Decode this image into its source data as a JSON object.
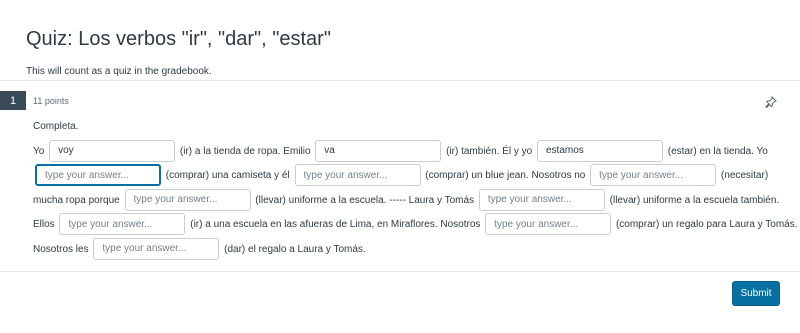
{
  "page": {
    "title": "Quiz: Los verbos \"ir\", \"dar\", \"estar\"",
    "subtitle": "This will count as a quiz in the gradebook."
  },
  "question": {
    "number": "1",
    "points": "11 points",
    "flag_icon": "pin-icon",
    "intro": "Completa.",
    "placeholder": "type your answer...",
    "answers": {
      "a1": "voy",
      "a2": "va",
      "a3": "estamos"
    },
    "text": {
      "t1": "Yo",
      "t2": "(ir) a la tienda de ropa. Emilio",
      "t3": "(ir) también. Él y yo",
      "t4": "(estar) en la tienda. Yo",
      "t5": "(comprar) una camiseta y él",
      "t6": "(comprar) un blue jean. Nosotros no",
      "t7": "(necesitar)",
      "t8": "mucha ropa porque",
      "t9": "(llevar) uniforme a la escuela. ----- Laura y Tomás",
      "t10": "(llevar) uniforme a la escuela también.",
      "t11": "Ellos",
      "t12": "(ir) a una escuela en las afueras de Lima, en Miraflores. Nosotros",
      "t13": "(comprar) un regalo para Laura y Tomás.",
      "t14": "Nosotros les",
      "t15": "(dar) el regalo a Laura y Tomás."
    }
  },
  "actions": {
    "submit_label": "Submit"
  },
  "colors": {
    "accent": "#0770a3",
    "question_badge": "#394b58"
  }
}
